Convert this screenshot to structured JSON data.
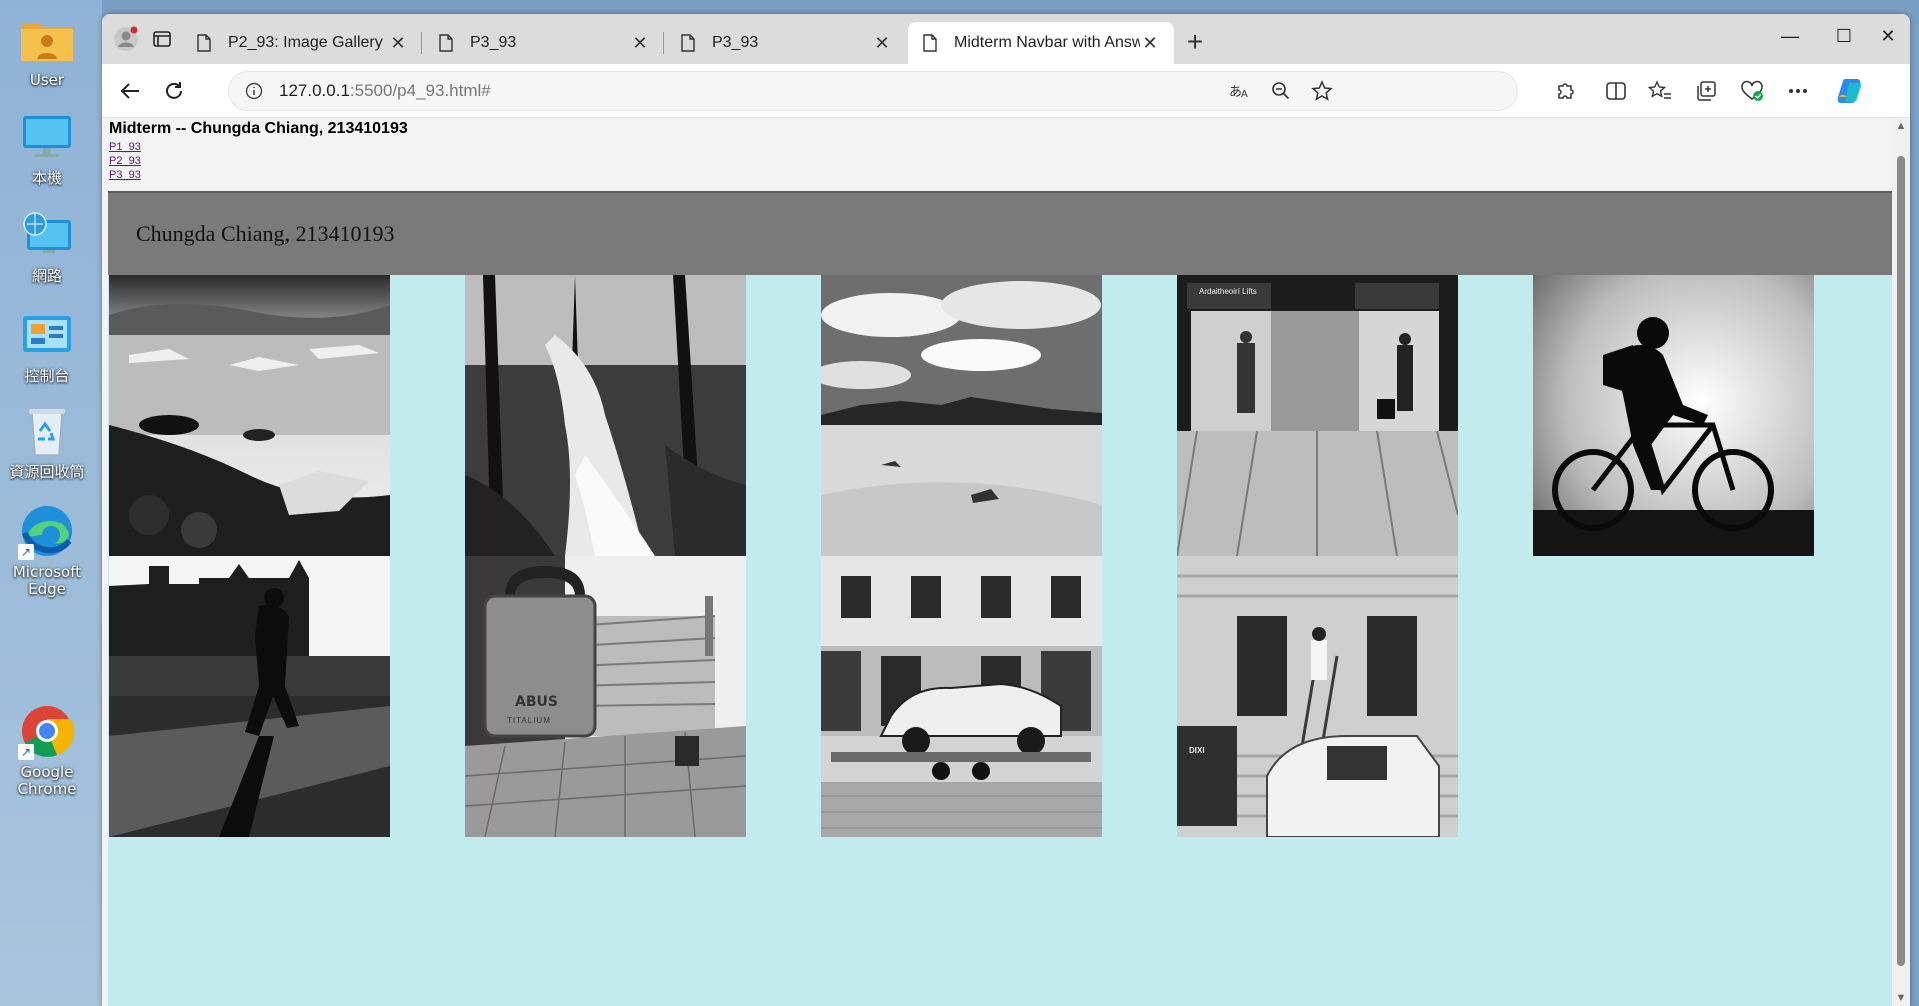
{
  "desktop": {
    "icons": [
      {
        "label": "User"
      },
      {
        "label": "本機"
      },
      {
        "label": "網路"
      },
      {
        "label": "控制台"
      },
      {
        "label": "資源回收筒"
      },
      {
        "label": "Microsoft Edge"
      },
      {
        "label": "Google Chrome"
      }
    ]
  },
  "browser": {
    "tabs": [
      {
        "title": "P2_93: Image Gallery"
      },
      {
        "title": "P3_93"
      },
      {
        "title": "P3_93"
      },
      {
        "title": "Midterm Navbar with Answers",
        "active": true
      }
    ],
    "address": {
      "host": "127.0.0.1",
      "rest": ":5500/p4_93.html#"
    }
  },
  "page": {
    "heading": "Midterm -- Chungda Chiang, 213410193",
    "links": [
      "P1_93",
      "P2_93",
      "P3_93"
    ],
    "banner": "Chungda Chiang, 213410193",
    "photos": [
      {
        "subject": "glacier-lagoon"
      },
      {
        "subject": "forest-waterfall"
      },
      {
        "subject": "desert-dunes"
      },
      {
        "subject": "airport-lifts"
      },
      {
        "subject": "cyclist-silhouette"
      },
      {
        "subject": "city-walker"
      },
      {
        "subject": "padlock-street"
      },
      {
        "subject": "car-on-trailer"
      },
      {
        "subject": "painter-on-ladder"
      }
    ],
    "lift_sign": "Ardaitheoirí Lifts",
    "padlock_brand": "ABUS",
    "padlock_model": "TITALIUM",
    "toilet_brand": "DIXI"
  },
  "colors": {
    "page_bg": "#c2ebee",
    "banner_bg": "#7a7a7a"
  }
}
